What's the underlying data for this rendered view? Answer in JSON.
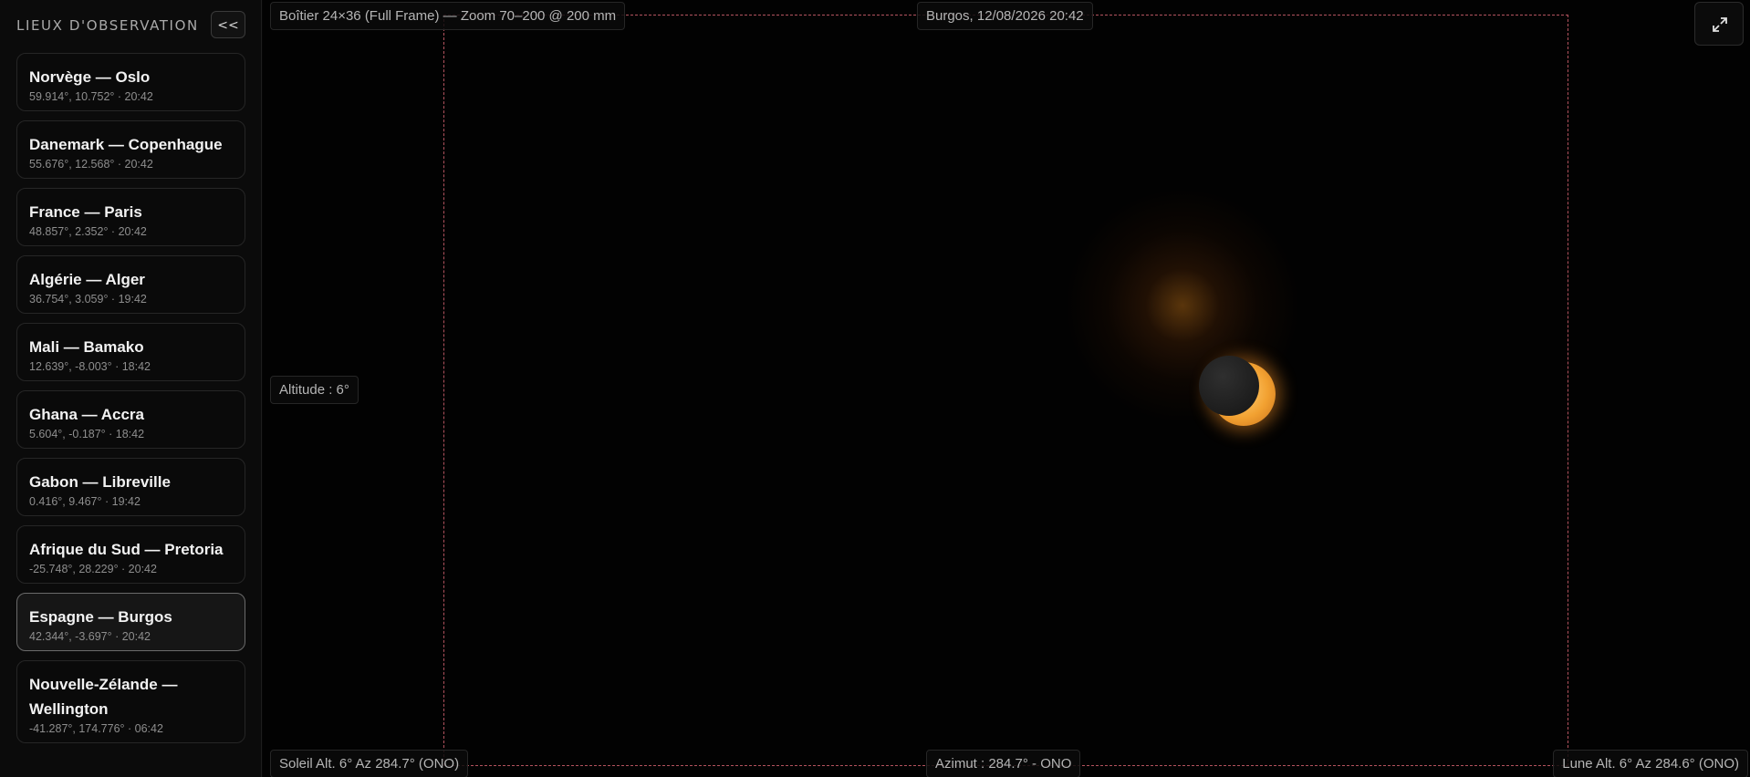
{
  "sidebar": {
    "title": "LIEUX D'OBSERVATION",
    "collapse_label": "<<",
    "locations": [
      {
        "name": "Norvège — Oslo",
        "meta": "59.914°, 10.752° · 20:42"
      },
      {
        "name": "Danemark — Copenhague",
        "meta": "55.676°, 12.568° · 20:42"
      },
      {
        "name": "France — Paris",
        "meta": "48.857°, 2.352° · 20:42"
      },
      {
        "name": "Algérie — Alger",
        "meta": "36.754°, 3.059° · 19:42"
      },
      {
        "name": "Mali — Bamako",
        "meta": "12.639°, -8.003° · 18:42"
      },
      {
        "name": "Ghana — Accra",
        "meta": "5.604°, -0.187° · 18:42"
      },
      {
        "name": "Gabon — Libreville",
        "meta": "0.416°, 9.467° · 19:42"
      },
      {
        "name": "Afrique du Sud — Pretoria",
        "meta": "-25.748°, 28.229° · 20:42"
      },
      {
        "name": "Espagne — Burgos",
        "meta": "42.344°, -3.697° · 20:42"
      },
      {
        "name": "Nouvelle-Zélande — Wellington",
        "meta": "-41.287°, 174.776° · 06:42"
      }
    ],
    "active_index": 8
  },
  "viewport": {
    "camera_label": "Boîtier 24×36 (Full Frame) — Zoom 70–200 @ 200 mm",
    "location_time_label": "Burgos, 12/08/2026 20:42",
    "altitude_label": "Altitude : 6°",
    "sun_label": "Soleil Alt. 6° Az 284.7° (ONO)",
    "azimuth_label": "Azimut : 284.7° - ONO",
    "moon_label": "Lune Alt. 6° Az 284.6° (ONO)",
    "expand_icon": "expand-icon"
  },
  "colors": {
    "frame_border": "#b3535e",
    "sun": "#f2a131",
    "moon": "#1c1c1c",
    "background": "#020202"
  }
}
